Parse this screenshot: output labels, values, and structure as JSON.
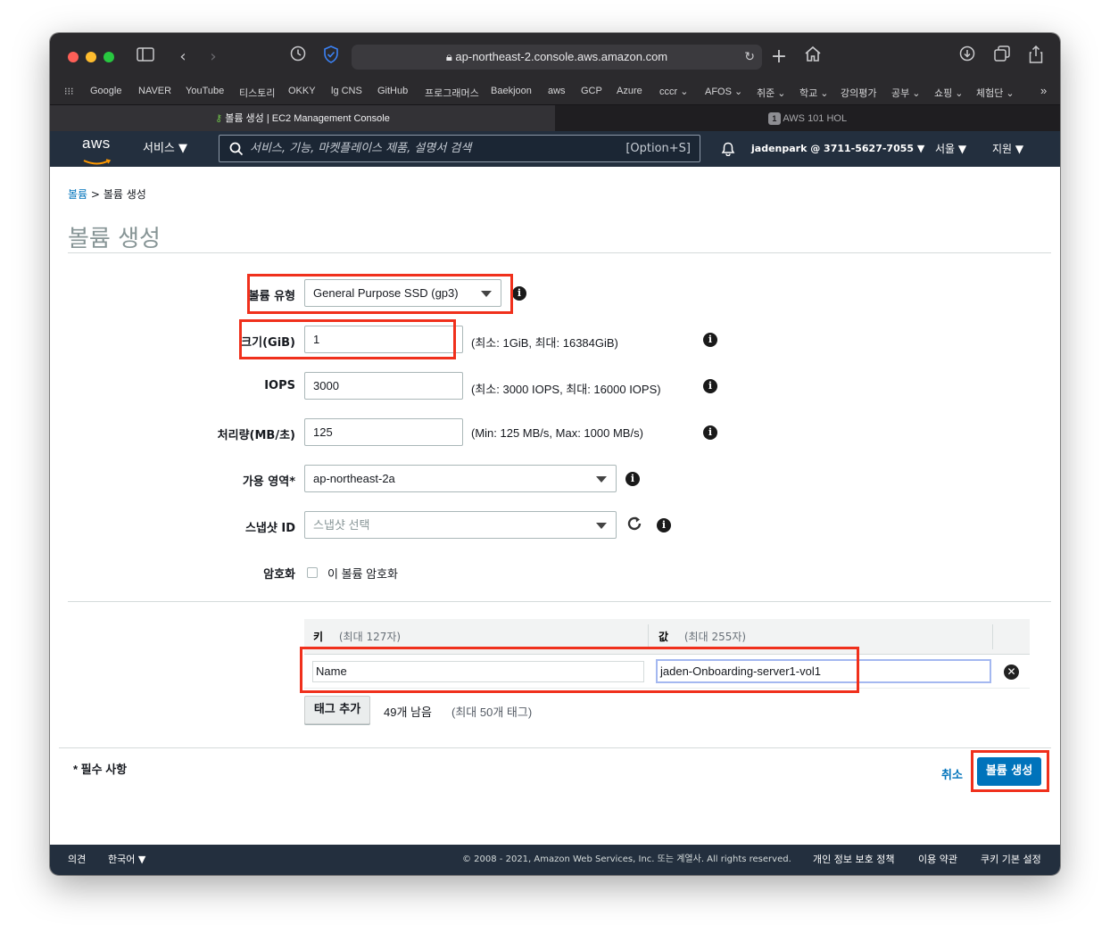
{
  "browser": {
    "url": "ap-northeast-2.console.aws.amazon.com",
    "bookmarks": [
      "Google",
      "NAVER",
      "YouTube",
      "티스토리",
      "OKKY",
      "lg CNS",
      "GitHub",
      "프로그래머스",
      "Baekjoon",
      "aws",
      "GCP",
      "Azure",
      "cccr ⌄",
      "AFOS ⌄",
      "취준 ⌄",
      "학교 ⌄",
      "강의평가",
      "공부 ⌄",
      "쇼핑 ⌄",
      "체험단 ⌄"
    ],
    "tabs": [
      {
        "label": "볼륨 생성 | EC2 Management Console"
      },
      {
        "label": "AWS 101 HOL",
        "badge": "1"
      }
    ]
  },
  "aws_nav": {
    "logo": "aws",
    "services": "서비스",
    "search_placeholder": "서비스, 기능, 마켓플레이스 제품, 설명서 검색",
    "search_shortcut": "[Option+S]",
    "account": "jadenpark @ 3711-5627-7055",
    "region": "서울",
    "support": "지원"
  },
  "breadcrumb": {
    "link": "볼륨",
    "separator": ">",
    "current": "볼륨 생성"
  },
  "page_title": "볼륨 생성",
  "form": {
    "volume_type": {
      "label": "볼륨 유형",
      "value": "General Purpose SSD (gp3)"
    },
    "size": {
      "label": "크기(GiB)",
      "value": "1",
      "hint": "(최소: 1GiB, 최대: 16384GiB)"
    },
    "iops": {
      "label": "IOPS",
      "value": "3000",
      "hint": "(최소: 3000 IOPS, 최대: 16000 IOPS)"
    },
    "throughput": {
      "label": "처리량(MB/초)",
      "value": "125",
      "hint": "(Min: 125 MB/s, Max: 1000 MB/s)"
    },
    "az": {
      "label": "가용 영역*",
      "value": "ap-northeast-2a"
    },
    "snapshot": {
      "label": "스냅샷 ID",
      "placeholder": "스냅샷 선택"
    },
    "encryption": {
      "label": "암호화",
      "checkbox_label": "이 볼륨 암호화",
      "checked": false
    }
  },
  "tags": {
    "key_header": "키",
    "key_hint": "(최대 127자)",
    "value_header": "값",
    "value_hint": "(최대 255자)",
    "rows": [
      {
        "key": "Name",
        "value": "jaden-Onboarding-server1-vol1"
      }
    ],
    "add_button": "태그 추가",
    "remaining": "49개 남음",
    "max_hint": "(최대 50개 태그)"
  },
  "required_note": "* 필수 사항",
  "cancel": "취소",
  "submit": "볼륨 생성",
  "footer": {
    "feedback": "의견",
    "language": "한국어",
    "copyright": "© 2008 - 2021, Amazon Web Services, Inc. 또는 계열사. All rights reserved.",
    "privacy": "개인 정보 보호 정책",
    "terms": "이용 약관",
    "cookies": "쿠키 기본 설정"
  },
  "colors": {
    "highlight": "#f0301c",
    "primary_button": "#0073bb",
    "nav_bg": "#232f3e"
  }
}
